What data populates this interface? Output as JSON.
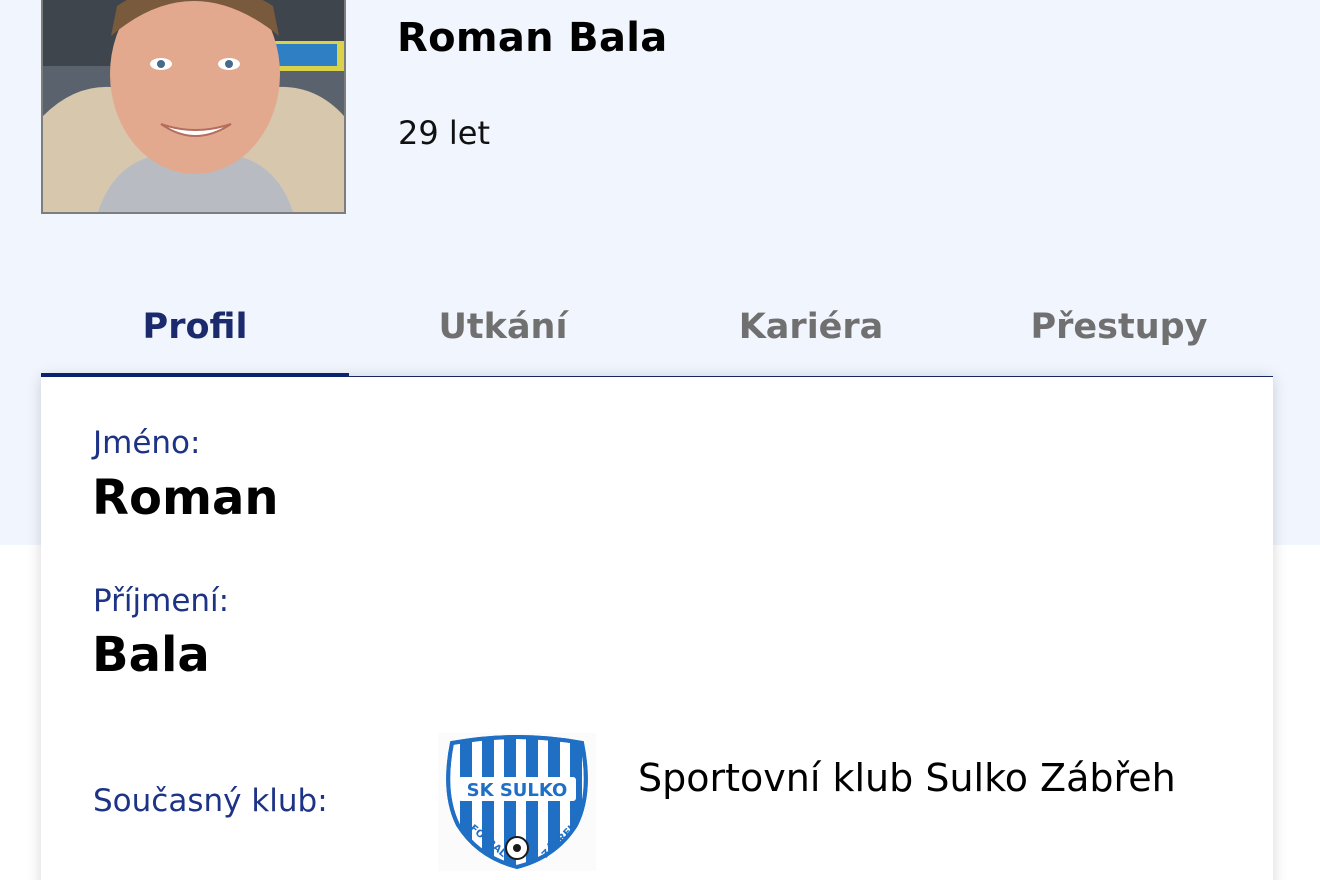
{
  "player": {
    "name": "Roman Bala",
    "age": "29 let",
    "photo_icon": "player-photo"
  },
  "tabs": [
    {
      "label": "Profil",
      "active": true
    },
    {
      "label": "Utkání",
      "active": false
    },
    {
      "label": "Kariéra",
      "active": false
    },
    {
      "label": "Přestupy",
      "active": false
    }
  ],
  "profile": {
    "first_name_label": "Jméno:",
    "first_name": "Roman",
    "last_name_label": "Příjmení:",
    "last_name": "Bala",
    "club_label": "Současný klub:",
    "club_name": "Sportovní klub Sulko Zábřeh",
    "club_logo": {
      "top_text": "SK SULKO",
      "left_text": "FOTBAL",
      "right_text": "ZÁBŘEH"
    }
  },
  "colors": {
    "accent": "#0c2575",
    "label": "#1d3385",
    "tab_inactive": "#707070",
    "band_background": "#f1f5fd",
    "logo_blue": "#1f6fc4"
  }
}
